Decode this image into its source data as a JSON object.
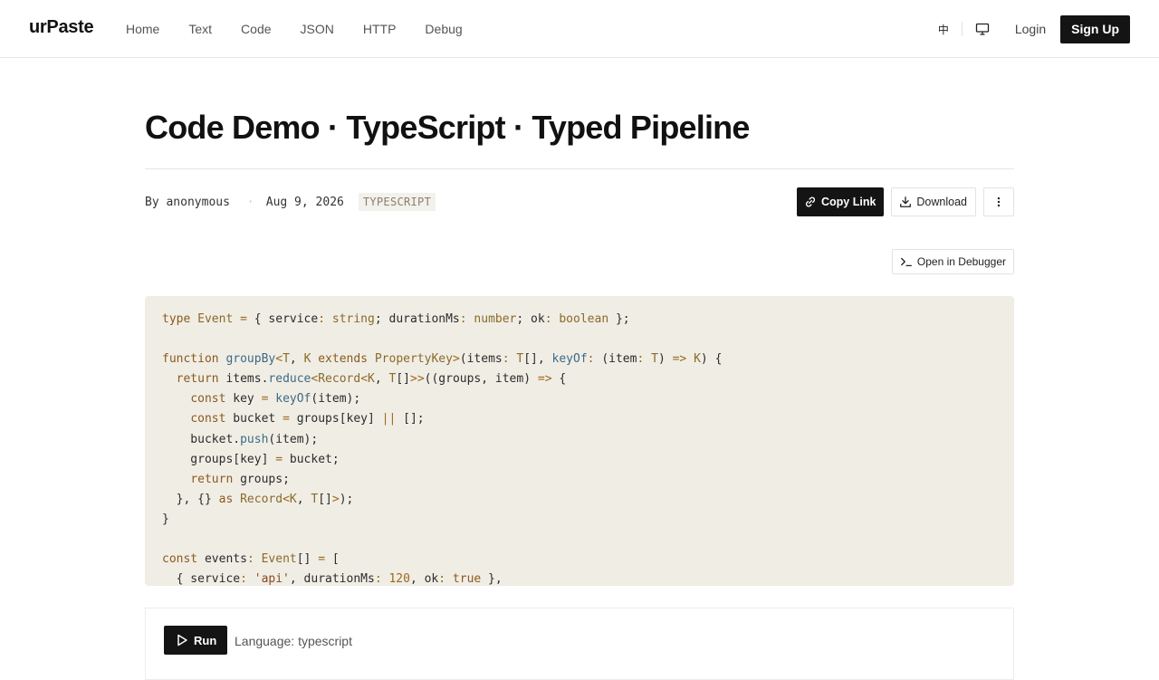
{
  "brand": "urPaste",
  "nav": {
    "items": [
      "Home",
      "Text",
      "Code",
      "JSON",
      "HTTP",
      "Debug"
    ]
  },
  "header_right": {
    "lang_label": "中",
    "login": "Login",
    "signup": "Sign Up"
  },
  "paste": {
    "title": "Code Demo · TypeScript · Typed Pipeline",
    "author": "By anonymous",
    "separator": "·",
    "date": "Aug 9, 2026",
    "language_badge": "TYPESCRIPT"
  },
  "actions": {
    "copy_link": "Copy Link",
    "download": "Download",
    "open_debugger": "Open in Debugger"
  },
  "code": {
    "lines": [
      "type Event = { service: string; durationMs: number; ok: boolean };",
      "",
      "function groupBy<T, K extends PropertyKey>(items: T[], keyOf: (item: T) => K) {",
      "  return items.reduce<Record<K, T[]>>((groups, item) => {",
      "    const key = keyOf(item);",
      "    const bucket = groups[key] || [];",
      "    bucket.push(item);",
      "    groups[key] = bucket;",
      "    return groups;",
      "  }, {} as Record<K, T[]>);",
      "}",
      "",
      "const events: Event[] = [",
      "  { service: 'api', durationMs: 120, ok: true },"
    ]
  },
  "runner": {
    "run_label": "Run",
    "language_label": "Language: typescript"
  },
  "colors": {
    "code_bg": "#f0ede5",
    "dark_button": "#141414",
    "keyword": "#8b5a1c",
    "function": "#3d6a85"
  },
  "icons": [
    "desktop-icon",
    "link-icon",
    "download-icon",
    "more-vertical-icon",
    "terminal-icon",
    "play-icon"
  ]
}
